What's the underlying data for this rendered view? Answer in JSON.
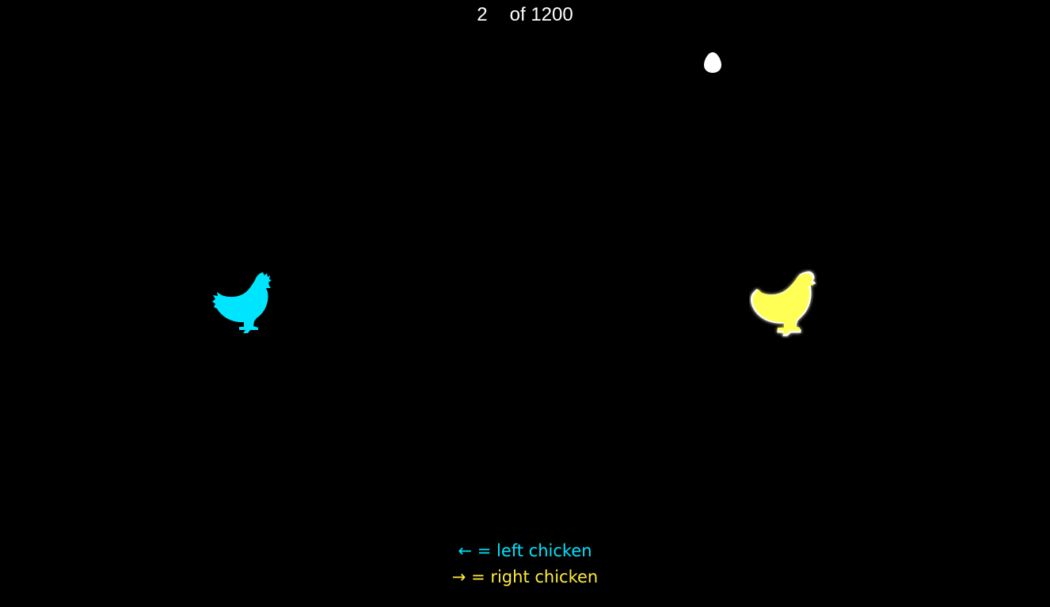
{
  "counter": {
    "current": "2",
    "total_text": "of 1200"
  },
  "legend": {
    "left_key": "←",
    "left_text": "= left chicken",
    "right_key": "→",
    "right_text": "= right chicken"
  },
  "colors": {
    "background": "#000000",
    "left_chicken": "#00e5ff",
    "right_chicken": "#ffff55",
    "right_chicken_glow": "#ffffff",
    "egg": "#ffffff"
  },
  "icons": {
    "egg": "egg-icon",
    "left_chicken": "chicken-icon",
    "right_chicken": "chicken-icon"
  },
  "state": {
    "selected_chicken": "right"
  }
}
